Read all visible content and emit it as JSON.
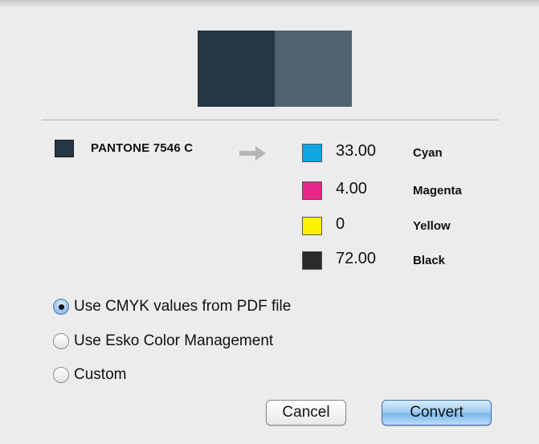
{
  "spot_color": {
    "name": "PANTONE 7546 C",
    "swatch_color": "#253746",
    "preview_converted_color": "#4f626d"
  },
  "inks": [
    {
      "value": "33.00",
      "name": "Cyan",
      "color": "#12a6e5"
    },
    {
      "value": "4.00",
      "name": "Magenta",
      "color": "#e7268a"
    },
    {
      "value": "0",
      "name": "Yellow",
      "color": "#fff200"
    },
    {
      "value": "72.00",
      "name": "Black",
      "color": "#2a2a2a"
    }
  ],
  "conversion_options": [
    {
      "label": "Use CMYK values from PDF file",
      "selected": true
    },
    {
      "label": "Use Esko Color Management",
      "selected": false
    },
    {
      "label": "Custom",
      "selected": false
    }
  ],
  "buttons": {
    "cancel": "Cancel",
    "convert": "Convert"
  },
  "icons": {
    "arrow": "right-arrow-icon"
  }
}
